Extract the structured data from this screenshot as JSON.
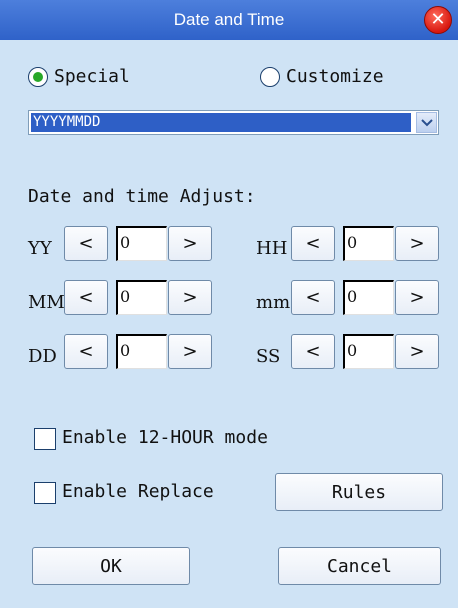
{
  "window": {
    "title": "Date and Time",
    "close_glyph": "✕"
  },
  "format_mode": {
    "special_label": "Special",
    "customize_label": "Customize",
    "selected": "Special"
  },
  "format_select": {
    "value": "YYYYMMDD",
    "arrow_glyph": "⌄"
  },
  "adjust_section": {
    "label": "Date and time Adjust:"
  },
  "spinners": [
    {
      "label": "YY",
      "value": "0",
      "dec": "<",
      "inc": ">"
    },
    {
      "label": "MM",
      "value": "0",
      "dec": "<",
      "inc": ">"
    },
    {
      "label": "DD",
      "value": "0",
      "dec": "<",
      "inc": ">"
    },
    {
      "label": "HH",
      "value": "0",
      "dec": "<",
      "inc": ">"
    },
    {
      "label": "mm",
      "value": "0",
      "dec": "<",
      "inc": ">"
    },
    {
      "label": "SS",
      "value": "0",
      "dec": "<",
      "inc": ">"
    }
  ],
  "options": {
    "enable_12hour_label": "Enable 12-HOUR mode",
    "enable_12hour_checked": false,
    "enable_replace_label": "Enable Replace",
    "enable_replace_checked": false
  },
  "buttons": {
    "rules": "Rules",
    "ok": "OK",
    "cancel": "Cancel"
  },
  "colors": {
    "titlebar": "#2f62c9",
    "background": "#cfe3f5",
    "selection": "#2e5fc6",
    "radio_dot": "#28a828"
  }
}
